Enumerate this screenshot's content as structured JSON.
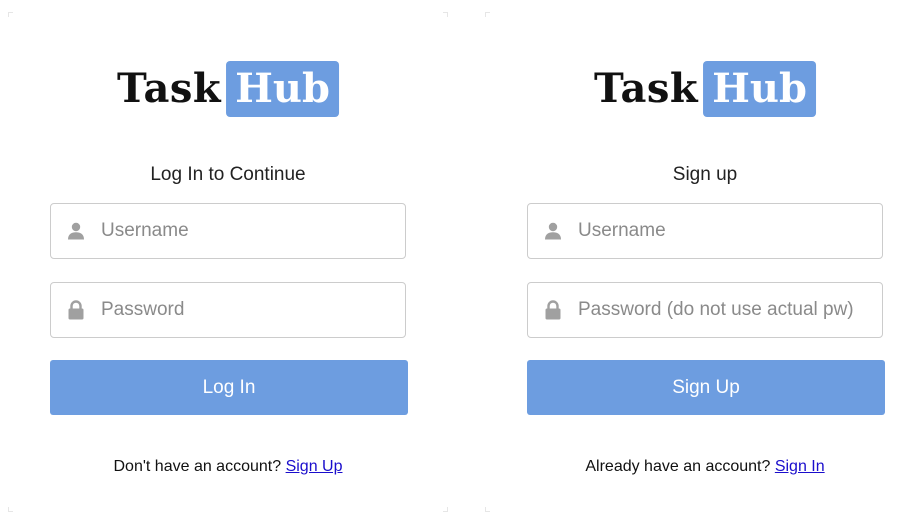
{
  "brand": {
    "word": "Task",
    "badge": "Hub",
    "badge_color": "#6d9de0"
  },
  "login": {
    "title": "Log In to Continue",
    "username_placeholder": "Username",
    "password_placeholder": "Password",
    "button_label": "Log In",
    "footer_text": "Don't have an account?",
    "footer_link": "Sign Up"
  },
  "signup": {
    "title": "Sign up",
    "username_placeholder": "Username",
    "password_placeholder": "Password (do not use actual pw)",
    "button_label": "Sign Up",
    "footer_text": "Already have an account?",
    "footer_link": "Sign In"
  },
  "icons": {
    "user": "user-icon",
    "lock": "lock-icon"
  },
  "colors": {
    "accent": "#6d9de0",
    "link": "#1a0dcc",
    "icon": "#a0a0a0"
  }
}
